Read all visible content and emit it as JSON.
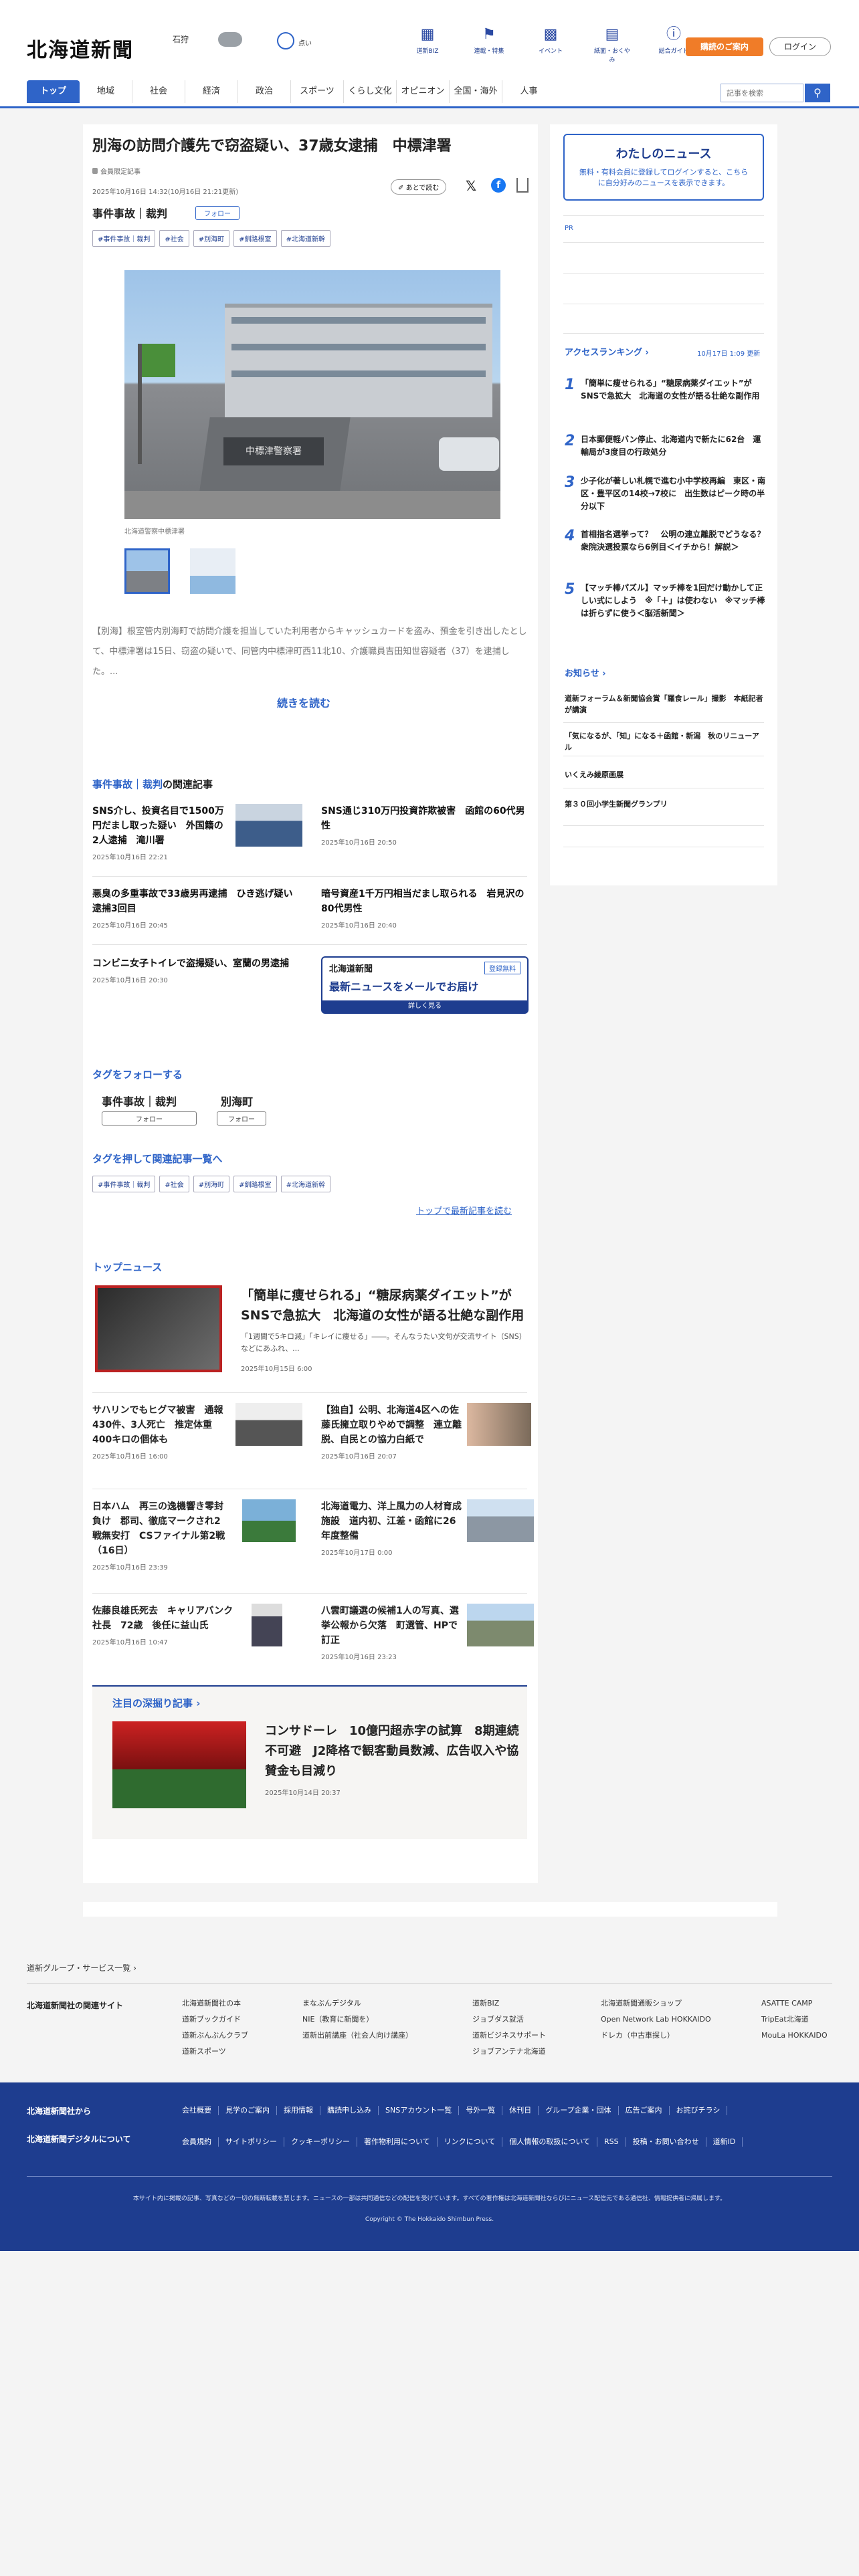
{
  "header": {
    "logo": "北海道新聞",
    "city": "石狩",
    "weather_label": "点い",
    "icons": [
      {
        "label": "道新BIZ",
        "icon": "book-icon"
      },
      {
        "label": "連載・特集",
        "icon": "flag-icon"
      },
      {
        "label": "イベント",
        "icon": "calendar-icon"
      },
      {
        "label": "紙面・おくやみ",
        "icon": "newspaper-icon"
      },
      {
        "label": "総合ガイド",
        "icon": "question-icon"
      }
    ],
    "subscribe": "購読のご案内",
    "login": "ログイン"
  },
  "nav": {
    "items": [
      "トップ",
      "地域",
      "社会",
      "経済",
      "政治",
      "スポーツ",
      "くらし文化",
      "オピニオン",
      "全国・海外",
      "人事"
    ],
    "search_placeholder": "記事を検索"
  },
  "article": {
    "title": "別海の訪問介護先で窃盗疑い、37歳女逮捕　中標津署",
    "member_label": "会員限定記事",
    "date": "2025年10月16日 14:32(10月16日 21:21更新)",
    "later": "あとで読む",
    "category": "事件事故｜裁判",
    "follow": "フォロー",
    "tags": [
      "#事件事故｜裁判",
      "#社会",
      "#別海町",
      "#釧路根室",
      "#北海道新幹"
    ],
    "photo_caption": "北海道警察中標津署",
    "building_sign": "中標津警察署",
    "body": "【別海】根室管内別海町で訪問介護を担当していた利用者からキャッシュカードを盗み、預金を引き出したとして、中標津署は15日、窃盗の疑いで、同管内中標津町西11北10、介護職員吉田知世容疑者（37）を逮捕した。...",
    "read_more": "続きを読む"
  },
  "related": {
    "heading_a": "事件事故｜裁判",
    "heading_b": "の関連記事",
    "items": [
      {
        "title": "SNS介し、投資名目で1500万円だまし取った疑い　外国籍の2人逮捕　滝川署",
        "date": "2025年10月16日 22:21"
      },
      {
        "title": "SNS通じ310万円投資詐欺被害　函館の60代男性",
        "date": "2025年10月16日 20:50"
      },
      {
        "title": "悪臭の多重事故で33歳男再逮捕　ひき逃げ疑い　逮捕3回目",
        "date": "2025年10月16日 20:45"
      },
      {
        "title": "暗号資産1千万円相当だまし取られる　岩見沢の80代男性",
        "date": "2025年10月16日 20:40"
      },
      {
        "title": "コンビニ女子トイレで盗撮疑い、室蘭の男逮捕",
        "date": "2025年10月16日 20:30"
      }
    ]
  },
  "mailad": {
    "logo": "北海道新聞",
    "badge": "登録無料",
    "headline": "最新ニュースをメールでお届け",
    "cta": "詳しく見る"
  },
  "follow_tags": {
    "heading": "タグをフォローする",
    "tags": [
      "事件事故｜裁判",
      "別海町"
    ],
    "button": "フォロー"
  },
  "tag_list": {
    "heading": "タグを押して関連記事一覧へ",
    "tags": [
      "#事件事故｜裁判",
      "#社会",
      "#別海町",
      "#釧路根室",
      "#北海道新幹"
    ],
    "more": "トップで最新記事を読む"
  },
  "top_news": {
    "heading": "トップニュース",
    "lead": {
      "title": "「簡単に痩せられる」“糖尿病薬ダイエット”がSNSで急拡大　北海道の女性が語る壮絶な副作用",
      "summary": "「1週間で5キロ減」「キレイに痩せる」――。そんなうたい文句が交流サイト（SNS）などにあふれ、...",
      "date": "2025年10月15日 6:00"
    },
    "items": [
      {
        "title": "サハリンでもヒグマ被害　通報430件、3人死亡　推定体重400キロの個体も",
        "date": "2025年10月16日 16:00"
      },
      {
        "title": "【独自】公明、北海道4区への佐藤氏擁立取りやめで調整　連立離脱、自民との協力白紙で",
        "date": "2025年10月16日 20:07"
      },
      {
        "title": "日本ハム　再三の逸機響き零封負け　郡司、徹底マークされ2戦無安打　CSファイナル第2戦（16日）",
        "date": "2025年10月16日 23:39"
      },
      {
        "title": "北海道電力、洋上風力の人材育成施設　道内初、江差・函館に26年度整備",
        "date": "2025年10月17日 0:00"
      },
      {
        "title": "佐藤良雄氏死去　キャリアバンク社長　72歳　後任に益山氏",
        "date": "2025年10月16日 10:47"
      },
      {
        "title": "八雲町議選の候補1人の写真、選挙公報から欠落　町選管、HPで訂正",
        "date": "2025年10月16日 23:23"
      }
    ]
  },
  "deep": {
    "heading": "注目の深掘り記事",
    "title": "コンサドーレ　10億円超赤字の試算　8期連続不可避　J2降格で観客動員数減、広告収入や協賛金も目減り",
    "date": "2025年10月14日 20:37"
  },
  "sidebar": {
    "mynews_title": "わたしのニュース",
    "mynews_text": "無料・有料会員に登録してログインすると、こちらに自分好みのニュースを表示できます。",
    "login_link": "ログイン",
    "pr": "PR",
    "ranking_title": "アクセスランキング",
    "ranking_date": "10月17日 1:09 更新",
    "ranking": [
      {
        "n": "1",
        "t": "「簡単に痩せられる」“糖尿病薬ダイエット”がSNSで急拡大　北海道の女性が語る壮絶な副作用"
      },
      {
        "n": "2",
        "t": "日本郵便軽バン停止、北海道内で新たに62台　運輸局が3度目の行政処分"
      },
      {
        "n": "3",
        "t": "少子化が著しい札幌で進む小中学校再編　東区・南区・豊平区の14校→7校に　出生数はピーク時の半分以下"
      },
      {
        "n": "4",
        "t": "首相指名選挙って？　公明の連立離脱でどうなる？　衆院決選投票なら6例目＜イチから！解説＞"
      },
      {
        "n": "5",
        "t": "【マッチ棒パズル】マッチ棒を1回だけ動かして正しい式にしよう　※「＋」は使わない　※マッチ棒は折らずに使う＜脳活新聞＞"
      }
    ],
    "notice_title": "お知らせ",
    "notices": [
      "道新フォーラム＆新聞協会賞「羅食レール」撮影　本紙記者が講演",
      "「気になるが、「知」になる＋函館・新潟　秋のリニューアル",
      "いくえみ綾原画展",
      "第３０回小学生新聞グランプリ"
    ]
  },
  "footer": {
    "group_link": "道新グループ・サービス一覧",
    "related_title": "北海道新聞社の関連サイト",
    "col1": [
      "北海道新聞社の本",
      "道新ブックガイド",
      "道新ぶんぶんクラブ",
      "道新スポーツ"
    ],
    "col2": [
      "まなぶんデジタル",
      "NIE（教育に新聞を）",
      "道新出前講座（社会人向け講座）"
    ],
    "col3": [
      "道新BIZ",
      "ジョブダス就活",
      "道新ビジネスサポート",
      "ジョブアンテナ北海道"
    ],
    "col4": [
      "北海道新聞通販ショップ",
      "Open Network Lab HOKKAIDO",
      "ドレカ（中古車探し）"
    ],
    "col5": [
      "ASATTE CAMP",
      "TripEat北海道",
      "MouLa HOKKAIDO"
    ],
    "dark_h1": "北海道新聞社から",
    "dark_h2": "北海道新聞デジタルについて",
    "dark_links1": [
      "会社概要",
      "見学のご案内",
      "採用情報",
      "購読申し込み",
      "SNSアカウント一覧",
      "号外一覧",
      "休刊日",
      "グループ企業・団体",
      "広告ご案内",
      "お詫びチラシ"
    ],
    "dark_links2": [
      "会員規約",
      "サイトポリシー",
      "クッキーポリシー",
      "著作物利用について",
      "リンクについて",
      "個人情報の取扱について",
      "RSS",
      "投稿・お問い合わせ",
      "道新ID"
    ],
    "notice": "本サイト内に掲載の記事、写真などの一切の無断転載を禁じます。ニュースの一部は共同通信などの配信を受けています。すべての著作権は北海道新聞社ならびにニュース配信元である通信社、情報提供者に帰属します。",
    "copyright": "Copyright © The Hokkaido Shimbun Press."
  }
}
